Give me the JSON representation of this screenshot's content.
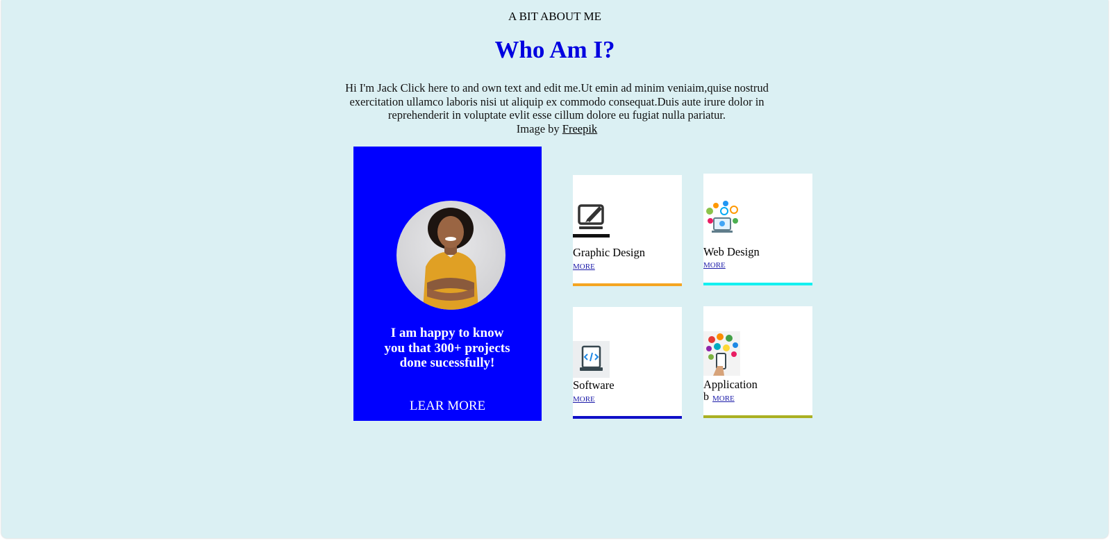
{
  "header": {
    "kicker": "A BIT ABOUT ME",
    "title": "Who Am I?",
    "intro": "Hi I'm Jack Click here to and own text and edit me.Ut emin ad minim veniaim,quise nostrud exercitation ullamco laboris nisi ut aliquip ex commodo consequat.Duis aute irure dolor in reprehenderit in voluptate evlit esse cillum dolore eu fugiat nulla pariatur.",
    "credit_prefix": "Image by",
    "credit_link": "Freepik"
  },
  "profile": {
    "message": "I am happy to know you that 300+ projects done sucessfully!",
    "cta": "LEAR MORE"
  },
  "services": [
    {
      "label": "Graphic Design",
      "more": "MORE",
      "icon": "laptop-pen-icon",
      "accent": "#f4a522"
    },
    {
      "label": "Web Design",
      "more": "MORE",
      "icon": "web-network-icon",
      "accent": "#13f0f0"
    },
    {
      "label": "Software",
      "more": "MORE",
      "icon": "code-laptop-icon",
      "accent": "#1010c8"
    },
    {
      "label": "Application",
      "prefix": "b",
      "more": "MORE",
      "icon": "apps-phone-icon",
      "accent": "#aab022"
    }
  ],
  "colors": {
    "page_bg": "#dbf0f3",
    "title": "#0000e0",
    "profile_bg": "#0000ff"
  }
}
